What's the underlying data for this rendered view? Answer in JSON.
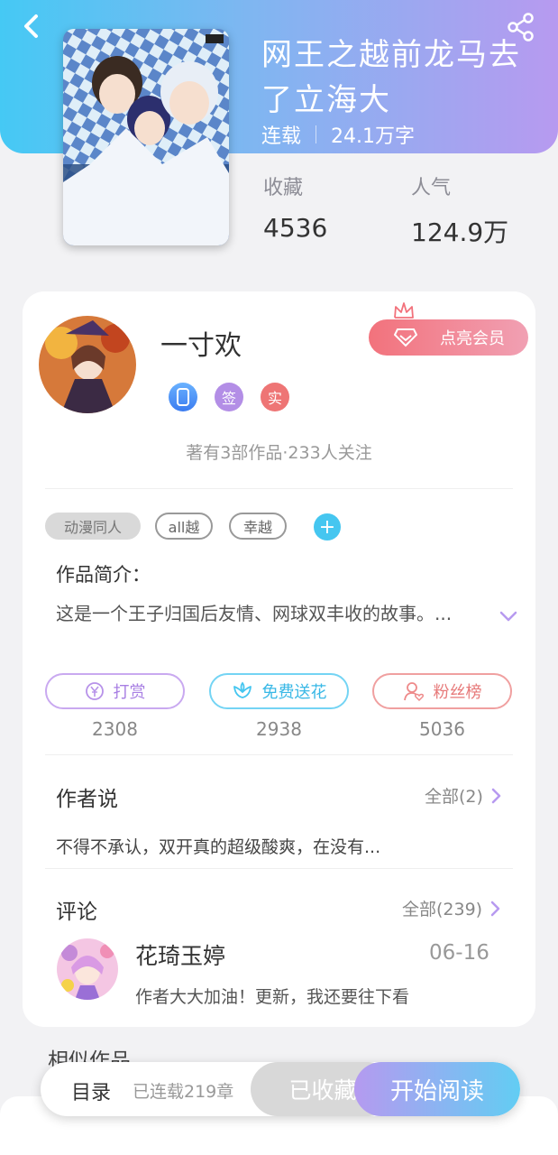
{
  "book": {
    "title": "网王之越前龙马去了立海大",
    "status": "连载",
    "word_count": "24.1万字",
    "favorites_label": "收藏",
    "favorites_value": "4536",
    "popularity_label": "人气",
    "popularity_value": "124.9万"
  },
  "author": {
    "name": "一寸欢",
    "vip_button": "点亮会员",
    "badges": [
      "签",
      "实"
    ],
    "summary": "著有3部作品·233人关注"
  },
  "tags": [
    "动漫同人",
    "all越",
    "幸越"
  ],
  "intro": {
    "heading": "作品简介：",
    "text": "这是一个王子归国后友情、网球双丰收的故事。..."
  },
  "actions": [
    {
      "label": "打赏",
      "count": "2308",
      "color": "#b792e9"
    },
    {
      "label": "免费送花",
      "count": "2938",
      "color": "#45c6f0"
    },
    {
      "label": "粉丝榜",
      "count": "5036",
      "color": "#ee8a8a"
    }
  ],
  "author_says": {
    "heading": "作者说",
    "more": "全部(2)",
    "text": "不得不承认，双开真的超级酸爽，在没有..."
  },
  "comments": {
    "heading": "评论",
    "more": "全部(239)",
    "items": [
      {
        "user": "花琦玉婷",
        "date": "06-16",
        "text": "作者大大加油！更新，我还要往下看"
      }
    ]
  },
  "similar_heading": "相似作品",
  "bottom_bar": {
    "toc": "目录",
    "chapters": "已连载219章",
    "favorited": "已收藏",
    "start_reading": "开始阅读"
  },
  "colors": {
    "header_gradient": [
      "#45c9f4",
      "#b79af0"
    ],
    "accent": "#45c6f0",
    "vip": "#f2727c"
  },
  "icons": [
    "back-arrow-icon",
    "share-icon",
    "phone-badge-icon",
    "crown-icon",
    "diamond-icon",
    "yen-coin-icon",
    "flower-icon",
    "fans-person-icon",
    "chevron-down-icon",
    "chevron-right-icon"
  ]
}
